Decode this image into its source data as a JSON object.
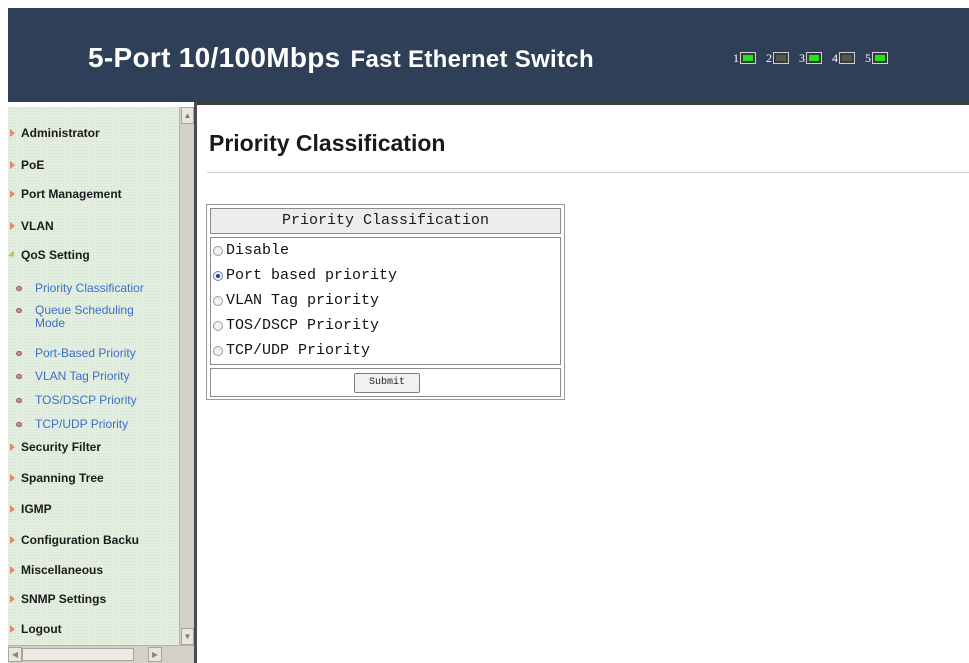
{
  "header": {
    "title_part1": "5-Port 10/100Mbps",
    "title_part2": "Fast Ethernet Switch",
    "ports": [
      {
        "num": "1",
        "status": "up"
      },
      {
        "num": "2",
        "status": "down"
      },
      {
        "num": "3",
        "status": "up"
      },
      {
        "num": "4",
        "status": "down"
      },
      {
        "num": "5",
        "status": "up"
      }
    ],
    "colors": {
      "banner": "#2e3f57",
      "port_up": "#22e41a"
    }
  },
  "sidebar": {
    "items": [
      {
        "label": "Administrator"
      },
      {
        "label": "PoE"
      },
      {
        "label": "Port Management"
      },
      {
        "label": "VLAN"
      },
      {
        "label": "QoS Setting"
      },
      {
        "label": "Security Filter"
      },
      {
        "label": "Spanning Tree"
      },
      {
        "label": "IGMP"
      },
      {
        "label": "Configuration Backu"
      },
      {
        "label": "Miscellaneous"
      },
      {
        "label": "SNMP Settings"
      },
      {
        "label": "Logout"
      }
    ],
    "qos_subitems": [
      {
        "label": "Priority Classificatior"
      },
      {
        "label": "Queue Scheduling Mode"
      },
      {
        "label": "Port-Based Priority"
      },
      {
        "label": "VLAN Tag Priority"
      },
      {
        "label": "TOS/DSCP Priority"
      },
      {
        "label": "TCP/UDP Priority"
      }
    ]
  },
  "main": {
    "page_title": "Priority Classification",
    "form": {
      "header": "Priority Classification",
      "options": [
        {
          "label": "Disable",
          "checked": false
        },
        {
          "label": "Port based priority",
          "checked": true
        },
        {
          "label": "VLAN Tag priority",
          "checked": false
        },
        {
          "label": "TOS/DSCP Priority",
          "checked": false
        },
        {
          "label": "TCP/UDP Priority",
          "checked": false
        }
      ],
      "submit_label": "Submit"
    }
  }
}
